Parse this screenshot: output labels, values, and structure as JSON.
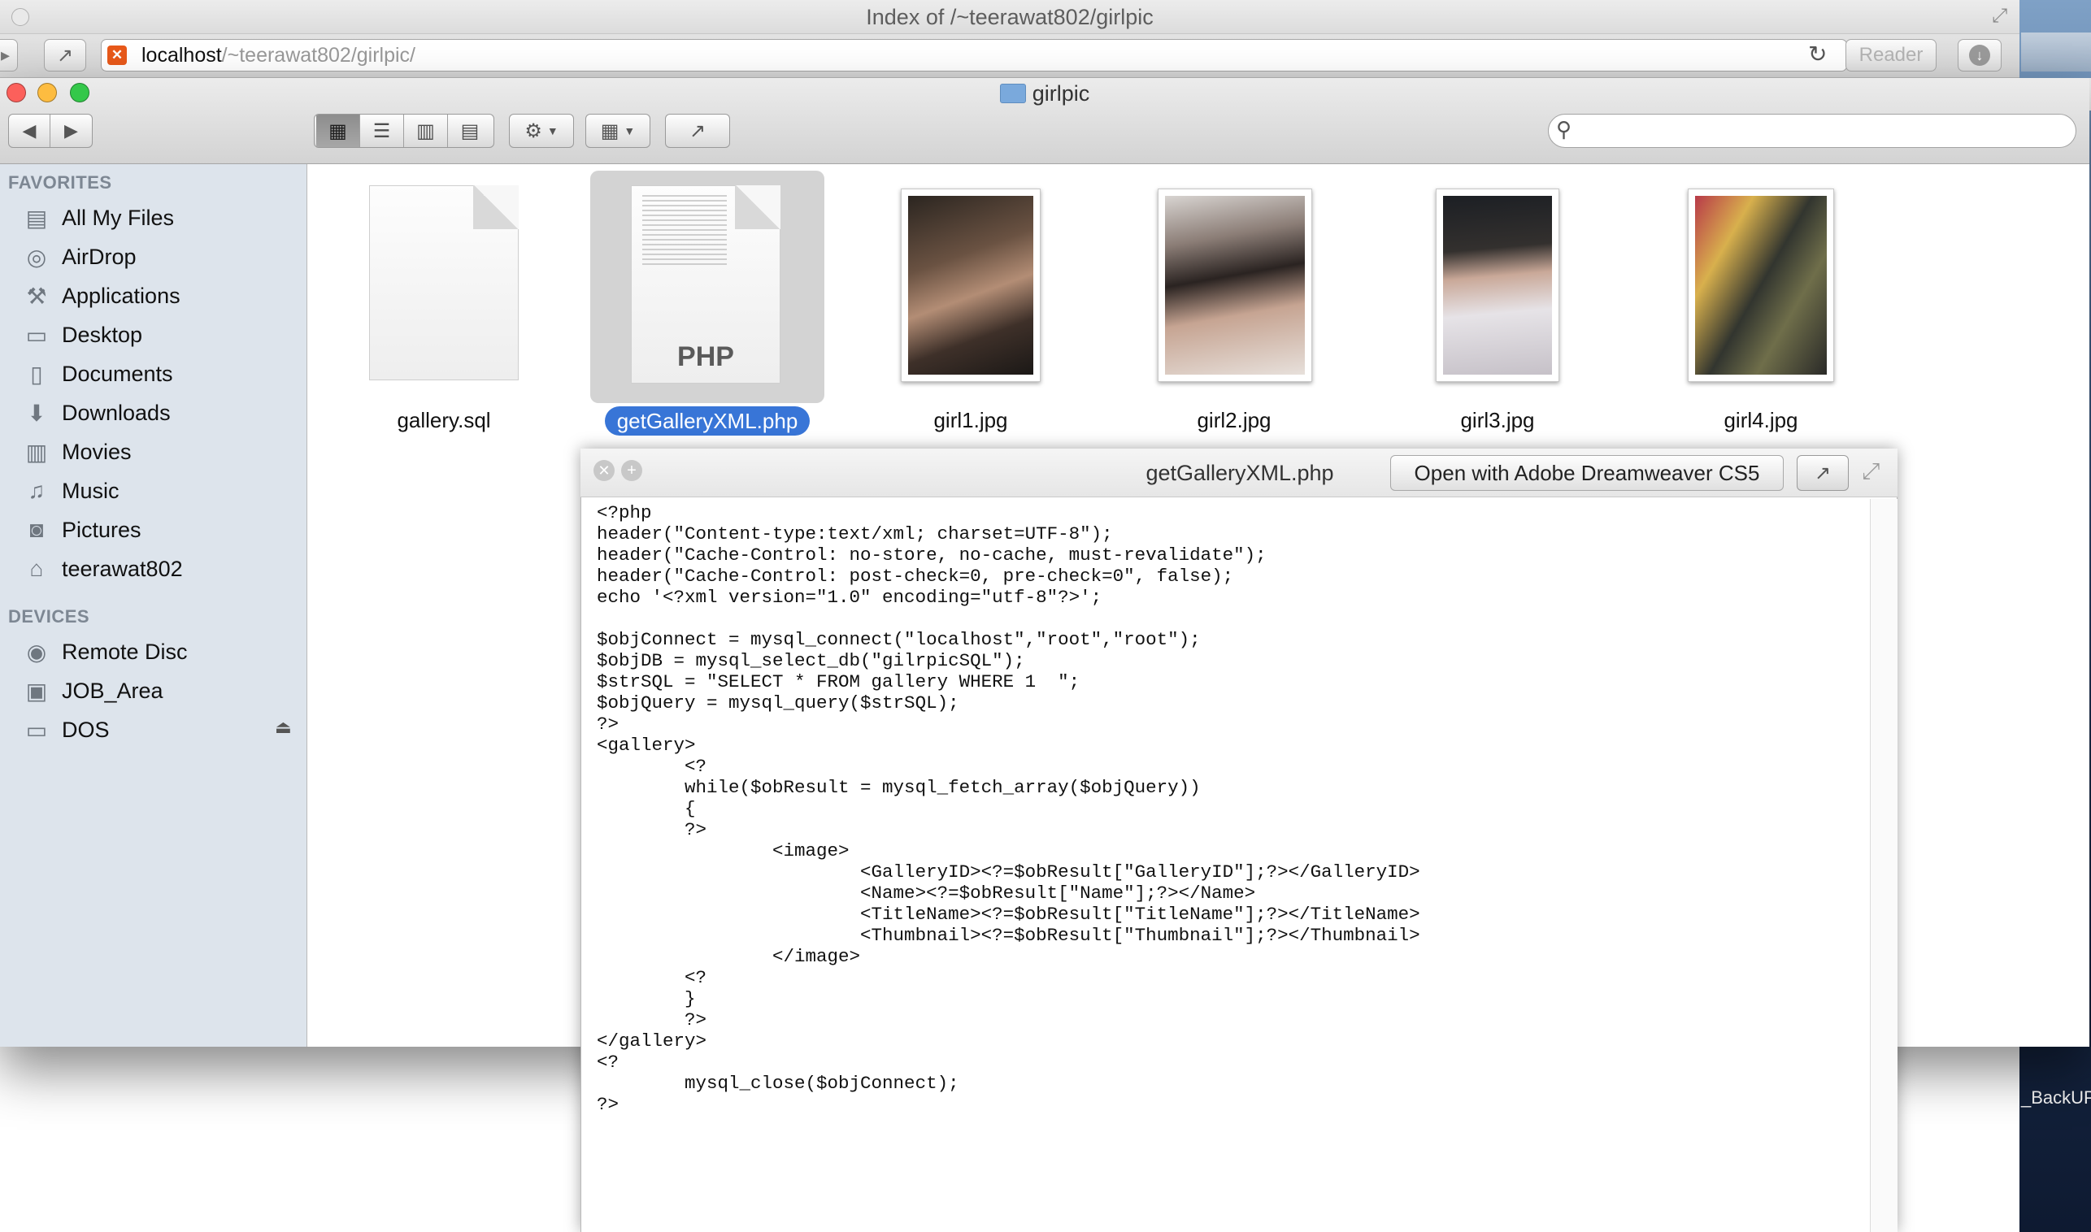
{
  "safari": {
    "title": "Index of /~teerawat802/girlpic",
    "url_host": "localhost",
    "url_path": "/~teerawat802/girlpic/",
    "reader_label": "Reader"
  },
  "finder": {
    "title": "girlpic",
    "sidebar": {
      "favorites_heading": "FAVORITES",
      "favorites": [
        {
          "label": "All My Files",
          "icon": "all-files-icon"
        },
        {
          "label": "AirDrop",
          "icon": "airdrop-icon"
        },
        {
          "label": "Applications",
          "icon": "applications-icon"
        },
        {
          "label": "Desktop",
          "icon": "desktop-icon"
        },
        {
          "label": "Documents",
          "icon": "documents-icon"
        },
        {
          "label": "Downloads",
          "icon": "downloads-icon"
        },
        {
          "label": "Movies",
          "icon": "movies-icon"
        },
        {
          "label": "Music",
          "icon": "music-icon"
        },
        {
          "label": "Pictures",
          "icon": "pictures-icon"
        },
        {
          "label": "teerawat802",
          "icon": "home-icon"
        }
      ],
      "devices_heading": "DEVICES",
      "devices": [
        {
          "label": "Remote Disc",
          "icon": "disc-icon"
        },
        {
          "label": "JOB_Area",
          "icon": "drive-icon"
        },
        {
          "label": "DOS",
          "icon": "drive-icon"
        }
      ]
    },
    "files": [
      {
        "name": "gallery.sql",
        "kind": "document"
      },
      {
        "name": "getGalleryXML.php",
        "kind": "php",
        "badge": "PHP",
        "selected": true
      },
      {
        "name": "girl1.jpg",
        "kind": "image"
      },
      {
        "name": "girl2.jpg",
        "kind": "image"
      },
      {
        "name": "girl3.jpg",
        "kind": "image"
      },
      {
        "name": "girl4.jpg",
        "kind": "image"
      }
    ]
  },
  "quicklook": {
    "title": "getGalleryXML.php",
    "open_with_label": "Open with Adobe Dreamweaver CS5",
    "code": "<?php\nheader(\"Content-type:text/xml; charset=UTF-8\");\nheader(\"Cache-Control: no-store, no-cache, must-revalidate\");\nheader(\"Cache-Control: post-check=0, pre-check=0\", false);\necho '<?xml version=\"1.0\" encoding=\"utf-8\"?>';\n\n$objConnect = mysql_connect(\"localhost\",\"root\",\"root\");\n$objDB = mysql_select_db(\"gilrpicSQL\");\n$strSQL = \"SELECT * FROM gallery WHERE 1  \";\n$objQuery = mysql_query($strSQL);\n?>\n<gallery>\n        <?\n        while($obResult = mysql_fetch_array($objQuery))\n        {\n        ?>\n                <image>\n                        <GalleryID><?=$obResult[\"GalleryID\"];?></GalleryID>\n                        <Name><?=$obResult[\"Name\"];?></Name>\n                        <TitleName><?=$obResult[\"TitleName\"];?></TitleName>\n                        <Thumbnail><?=$obResult[\"Thumbnail\"];?></Thumbnail>\n                </image>\n        <?\n        }\n        ?>\n</gallery>\n<?\n        mysql_close($objConnect);\n?>"
  },
  "desktop": {
    "backup_label": "_BackUP"
  },
  "colors": {
    "selection": "#3875d7",
    "sidebar_bg": "#dde4ec",
    "close": "#fc605b",
    "minimize": "#fdbc40",
    "zoom": "#34c84a"
  }
}
